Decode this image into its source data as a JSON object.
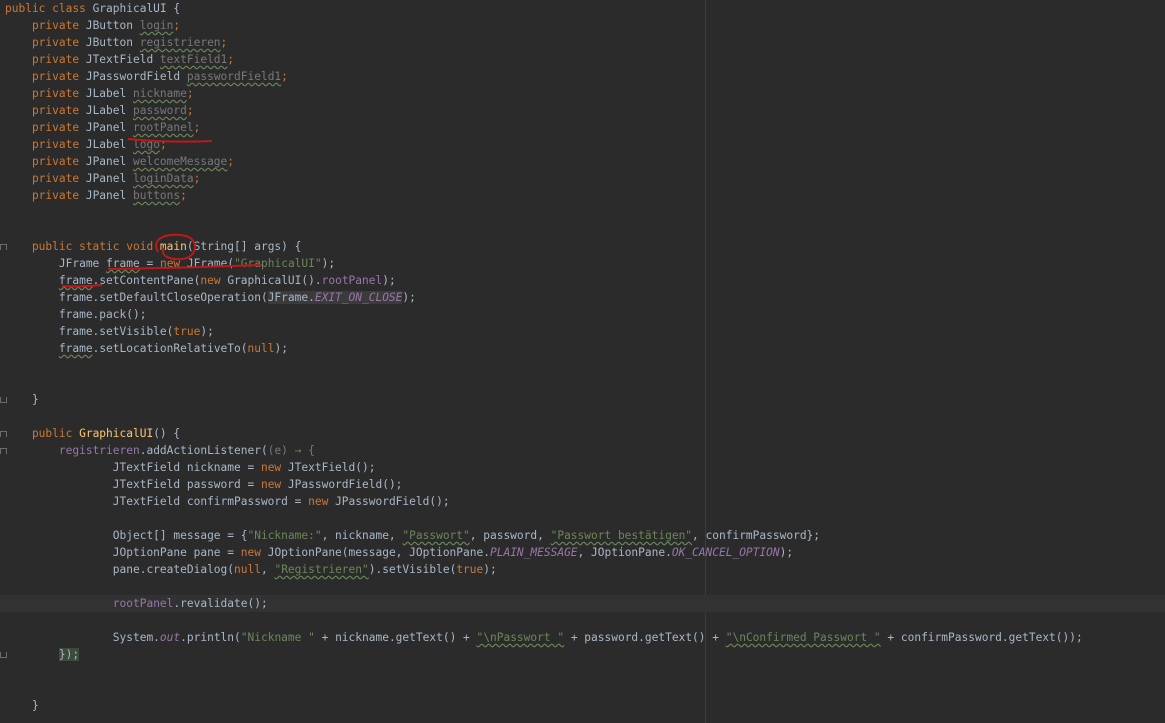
{
  "editor": {
    "lines": [
      {
        "segments": [
          {
            "t": "public class ",
            "c": "kw"
          },
          {
            "t": "GraphicalUI",
            "c": ""
          },
          {
            "t": " {",
            "c": ""
          }
        ]
      },
      {
        "segments": [
          {
            "t": "    private ",
            "c": "kw"
          },
          {
            "t": "JButton ",
            "c": ""
          },
          {
            "t": "login",
            "c": "unused typo"
          },
          {
            "t": ";",
            "c": "kw"
          }
        ]
      },
      {
        "segments": [
          {
            "t": "    private ",
            "c": "kw"
          },
          {
            "t": "JButton ",
            "c": ""
          },
          {
            "t": "registrieren",
            "c": "unused typo"
          },
          {
            "t": ";",
            "c": "kw"
          }
        ]
      },
      {
        "segments": [
          {
            "t": "    private ",
            "c": "kw"
          },
          {
            "t": "JTextField ",
            "c": ""
          },
          {
            "t": "textField1",
            "c": "unused typo"
          },
          {
            "t": ";",
            "c": "kw"
          }
        ]
      },
      {
        "segments": [
          {
            "t": "    private ",
            "c": "kw"
          },
          {
            "t": "JPasswordField ",
            "c": ""
          },
          {
            "t": "passwordField1",
            "c": "unused typo"
          },
          {
            "t": ";",
            "c": "kw"
          }
        ]
      },
      {
        "segments": [
          {
            "t": "    private ",
            "c": "kw"
          },
          {
            "t": "JLabel ",
            "c": ""
          },
          {
            "t": "nickname",
            "c": "unused typo"
          },
          {
            "t": ";",
            "c": "kw"
          }
        ]
      },
      {
        "segments": [
          {
            "t": "    private ",
            "c": "kw"
          },
          {
            "t": "JLabel ",
            "c": ""
          },
          {
            "t": "password",
            "c": "unused typo"
          },
          {
            "t": ";",
            "c": "kw"
          }
        ]
      },
      {
        "segments": [
          {
            "t": "    private ",
            "c": "kw"
          },
          {
            "t": "JPanel ",
            "c": ""
          },
          {
            "t": "rootPanel",
            "c": "unused typo"
          },
          {
            "t": ";",
            "c": "kw"
          }
        ]
      },
      {
        "segments": [
          {
            "t": "    private ",
            "c": "kw"
          },
          {
            "t": "JLabel ",
            "c": ""
          },
          {
            "t": "logo",
            "c": "unused typo"
          },
          {
            "t": ";",
            "c": "kw"
          }
        ]
      },
      {
        "segments": [
          {
            "t": "    private ",
            "c": "kw"
          },
          {
            "t": "JPanel ",
            "c": ""
          },
          {
            "t": "welcomeMessage",
            "c": "unused typo"
          },
          {
            "t": ";",
            "c": "kw"
          }
        ]
      },
      {
        "segments": [
          {
            "t": "    private ",
            "c": "kw"
          },
          {
            "t": "JPanel ",
            "c": ""
          },
          {
            "t": "loginData",
            "c": "unused typo"
          },
          {
            "t": ";",
            "c": "kw"
          }
        ]
      },
      {
        "segments": [
          {
            "t": "    private ",
            "c": "kw"
          },
          {
            "t": "JPanel ",
            "c": ""
          },
          {
            "t": "buttons",
            "c": "unused typo"
          },
          {
            "t": ";",
            "c": "kw"
          }
        ]
      },
      {
        "segments": []
      },
      {
        "segments": []
      },
      {
        "segments": [
          {
            "t": "    public static void ",
            "c": "kw"
          },
          {
            "t": "main",
            "c": "fn"
          },
          {
            "t": "(String[] args) {",
            "c": ""
          }
        ]
      },
      {
        "segments": [
          {
            "t": "        JFrame ",
            "c": ""
          },
          {
            "t": "frame",
            "c": "typo"
          },
          {
            "t": " = ",
            "c": ""
          },
          {
            "t": "new ",
            "c": "kw"
          },
          {
            "t": "JFrame(",
            "c": ""
          },
          {
            "t": "\"GraphicalUI\"",
            "c": "str"
          },
          {
            "t": ");",
            "c": ""
          }
        ]
      },
      {
        "segments": [
          {
            "t": "        ",
            "c": ""
          },
          {
            "t": "frame",
            "c": "typo"
          },
          {
            "t": ".setContentPane(",
            "c": ""
          },
          {
            "t": "new ",
            "c": "kw"
          },
          {
            "t": "GraphicalUI().",
            "c": ""
          },
          {
            "t": "rootPanel",
            "c": "fld"
          },
          {
            "t": ");",
            "c": ""
          }
        ]
      },
      {
        "segments": [
          {
            "t": "        frame.setDefaultCloseOperation(",
            "c": ""
          },
          {
            "t": "JFrame.",
            "c": "gray-bg"
          },
          {
            "t": "EXIT_ON_CLOSE",
            "c": "fld ital gray-bg"
          },
          {
            "t": ");",
            "c": ""
          }
        ]
      },
      {
        "segments": [
          {
            "t": "        frame.pack();",
            "c": ""
          }
        ]
      },
      {
        "segments": [
          {
            "t": "        frame.setVisible(",
            "c": ""
          },
          {
            "t": "true",
            "c": "kw"
          },
          {
            "t": ");",
            "c": ""
          }
        ]
      },
      {
        "segments": [
          {
            "t": "        ",
            "c": ""
          },
          {
            "t": "frame",
            "c": "typo"
          },
          {
            "t": ".setLocationRelativeTo(",
            "c": ""
          },
          {
            "t": "null",
            "c": "kw"
          },
          {
            "t": ");",
            "c": ""
          }
        ]
      },
      {
        "segments": []
      },
      {
        "segments": []
      },
      {
        "segments": [
          {
            "t": "    }",
            "c": ""
          }
        ]
      },
      {
        "segments": []
      },
      {
        "segments": [
          {
            "t": "    public ",
            "c": "kw"
          },
          {
            "t": "GraphicalUI",
            "c": "fn"
          },
          {
            "t": "() {",
            "c": ""
          }
        ]
      },
      {
        "segments": [
          {
            "t": "        ",
            "c": ""
          },
          {
            "t": "registrieren",
            "c": "fld"
          },
          {
            "t": ".addActionListener(",
            "c": ""
          },
          {
            "t": "(e) → {",
            "c": "unused"
          }
        ]
      },
      {
        "segments": [
          {
            "t": "                JTextField nickname = ",
            "c": ""
          },
          {
            "t": "new ",
            "c": "kw"
          },
          {
            "t": "JTextField();",
            "c": ""
          }
        ]
      },
      {
        "segments": [
          {
            "t": "                JTextField password = ",
            "c": ""
          },
          {
            "t": "new ",
            "c": "kw"
          },
          {
            "t": "JPasswordField();",
            "c": ""
          }
        ]
      },
      {
        "segments": [
          {
            "t": "                JTextField confirmPassword = ",
            "c": ""
          },
          {
            "t": "new ",
            "c": "kw"
          },
          {
            "t": "JPasswordField();",
            "c": ""
          }
        ]
      },
      {
        "segments": []
      },
      {
        "segments": [
          {
            "t": "                Object[] message = {",
            "c": ""
          },
          {
            "t": "\"Nickname:\"",
            "c": "str"
          },
          {
            "t": ", nickname, ",
            "c": ""
          },
          {
            "t": "\"Passwort\"",
            "c": "str typo"
          },
          {
            "t": ", password, ",
            "c": ""
          },
          {
            "t": "\"Passwort bestätigen\"",
            "c": "str typo"
          },
          {
            "t": ", confirmPassword};",
            "c": ""
          }
        ]
      },
      {
        "segments": [
          {
            "t": "                JOptionPane pane = ",
            "c": ""
          },
          {
            "t": "new ",
            "c": "kw"
          },
          {
            "t": "JOptionPane(message, JOptionPane.",
            "c": ""
          },
          {
            "t": "PLAIN_MESSAGE",
            "c": "fld ital"
          },
          {
            "t": ", JOptionPane.",
            "c": ""
          },
          {
            "t": "OK_CANCEL_OPTION",
            "c": "fld ital"
          },
          {
            "t": ");",
            "c": ""
          }
        ]
      },
      {
        "segments": [
          {
            "t": "                pane.createDialog(",
            "c": ""
          },
          {
            "t": "null",
            "c": "kw"
          },
          {
            "t": ", ",
            "c": ""
          },
          {
            "t": "\"Registrieren\"",
            "c": "str typo"
          },
          {
            "t": ").setVisible(",
            "c": ""
          },
          {
            "t": "true",
            "c": "kw"
          },
          {
            "t": ");",
            "c": ""
          }
        ]
      },
      {
        "segments": []
      },
      {
        "segments": [
          {
            "t": "                ",
            "c": ""
          },
          {
            "t": "rootPanel",
            "c": "fld"
          },
          {
            "t": ".revalidate();",
            "c": ""
          }
        ],
        "current": true
      },
      {
        "segments": []
      },
      {
        "segments": [
          {
            "t": "                System.",
            "c": ""
          },
          {
            "t": "out",
            "c": "fld ital"
          },
          {
            "t": ".println(",
            "c": ""
          },
          {
            "t": "\"Nickname \"",
            "c": "str"
          },
          {
            "t": " + nickname.getText() + ",
            "c": ""
          },
          {
            "t": "\"\\nPasswort \"",
            "c": "str typo"
          },
          {
            "t": " + password.getText() + ",
            "c": ""
          },
          {
            "t": "\"\\nConfirmed Passwort \"",
            "c": "str typo"
          },
          {
            "t": " + confirmPassword.getText());",
            "c": ""
          }
        ]
      },
      {
        "segments": [
          {
            "t": "        ",
            "c": ""
          },
          {
            "t": "});",
            "c": "hl"
          }
        ]
      },
      {
        "segments": []
      },
      {
        "segments": []
      },
      {
        "segments": [
          {
            "t": "    }",
            "c": ""
          }
        ]
      }
    ]
  }
}
